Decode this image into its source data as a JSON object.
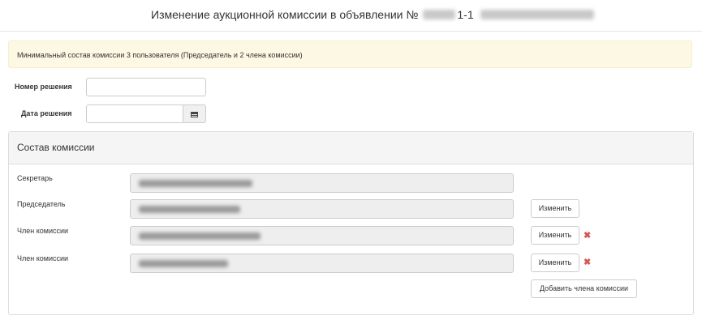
{
  "header": {
    "title_prefix": "Изменение аукционной комиссии в объявлении №",
    "title_number_suffix": "1-1"
  },
  "alert": {
    "text": "Минимальный состав комиссии 3 пользователя (Председатель и 2 члена комиссии)"
  },
  "form": {
    "decision_number_label": "Номер решения",
    "decision_number_value": "",
    "decision_date_label": "Дата решения",
    "decision_date_value": ""
  },
  "panel": {
    "title": "Состав комиссии",
    "members": [
      {
        "role": "Секретарь",
        "value_hidden": true
      },
      {
        "role": "Председатель",
        "value_hidden": true,
        "change_label": "Изменить"
      },
      {
        "role": "Член комиссии",
        "value_hidden": true,
        "change_label": "Изменить",
        "removable": true
      },
      {
        "role": "Член комиссии",
        "value_hidden": true,
        "change_label": "Изменить",
        "removable": true
      }
    ],
    "add_member_label": "Добавить члена комиссии"
  },
  "icons": {
    "calendar": "calendar-icon",
    "remove": "remove-icon"
  },
  "colors": {
    "alert_bg": "#fcf8e3",
    "remove": "#d9534f",
    "readonly_field": "#eeeeee"
  }
}
